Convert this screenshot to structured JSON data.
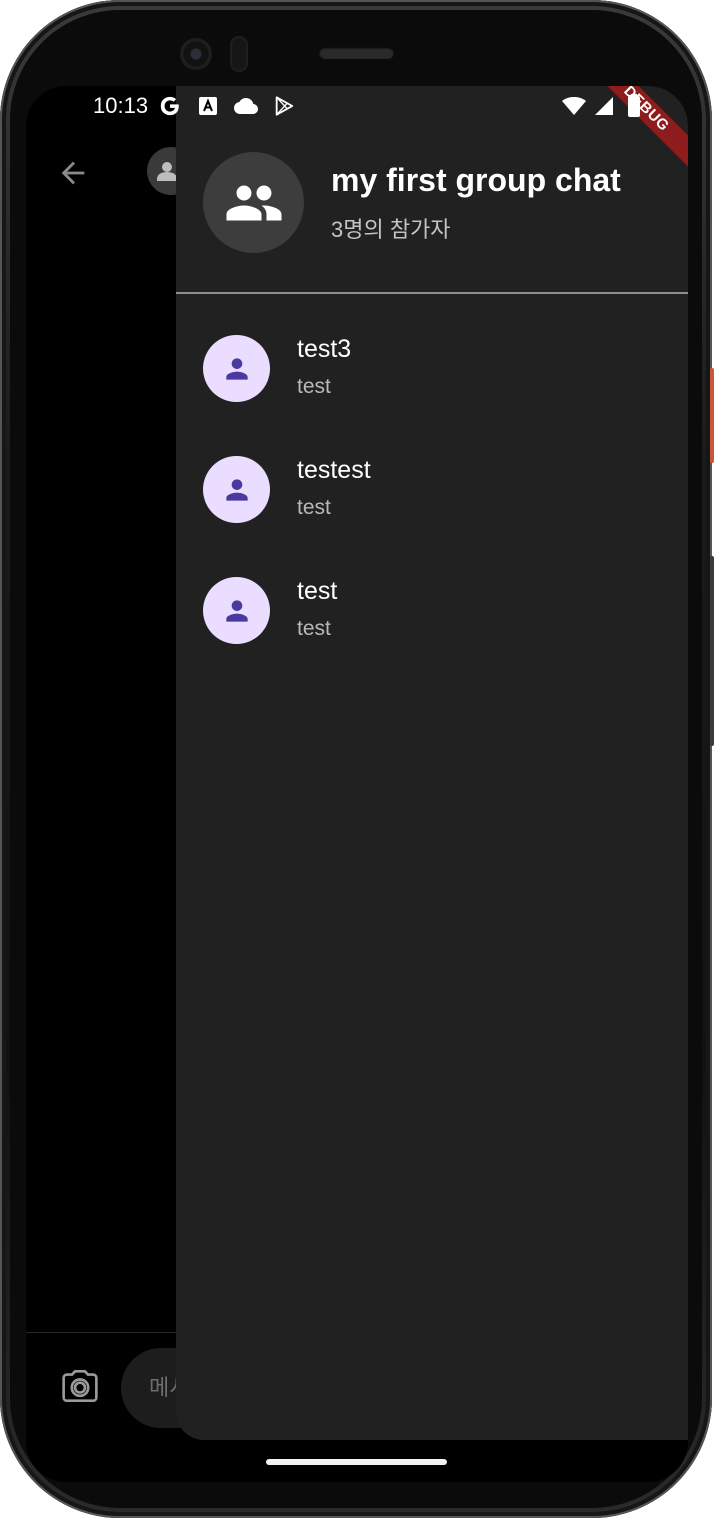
{
  "status_bar": {
    "time": "10:13",
    "left_icons": [
      "google-g-icon",
      "translate-a-icon",
      "cloud-icon",
      "play-store-icon"
    ],
    "right_icons": [
      "wifi-icon",
      "cell-signal-icon",
      "battery-icon"
    ]
  },
  "background_chat": {
    "input_placeholder": "메시"
  },
  "drawer": {
    "group_name": "my first group chat",
    "participant_count_text": "3명의 참가자",
    "participants": [
      {
        "name": "test3",
        "subtitle": "test"
      },
      {
        "name": "testest",
        "subtitle": "test"
      },
      {
        "name": "test",
        "subtitle": "test"
      }
    ]
  },
  "debug_banner": "DEBUG",
  "colors": {
    "drawer_bg": "#212121",
    "avatar_bg": "#eaddff",
    "avatar_icon": "#4a3aa0",
    "group_avatar_bg": "#3d3d3d",
    "debug_banner": "#8e1c1c"
  }
}
